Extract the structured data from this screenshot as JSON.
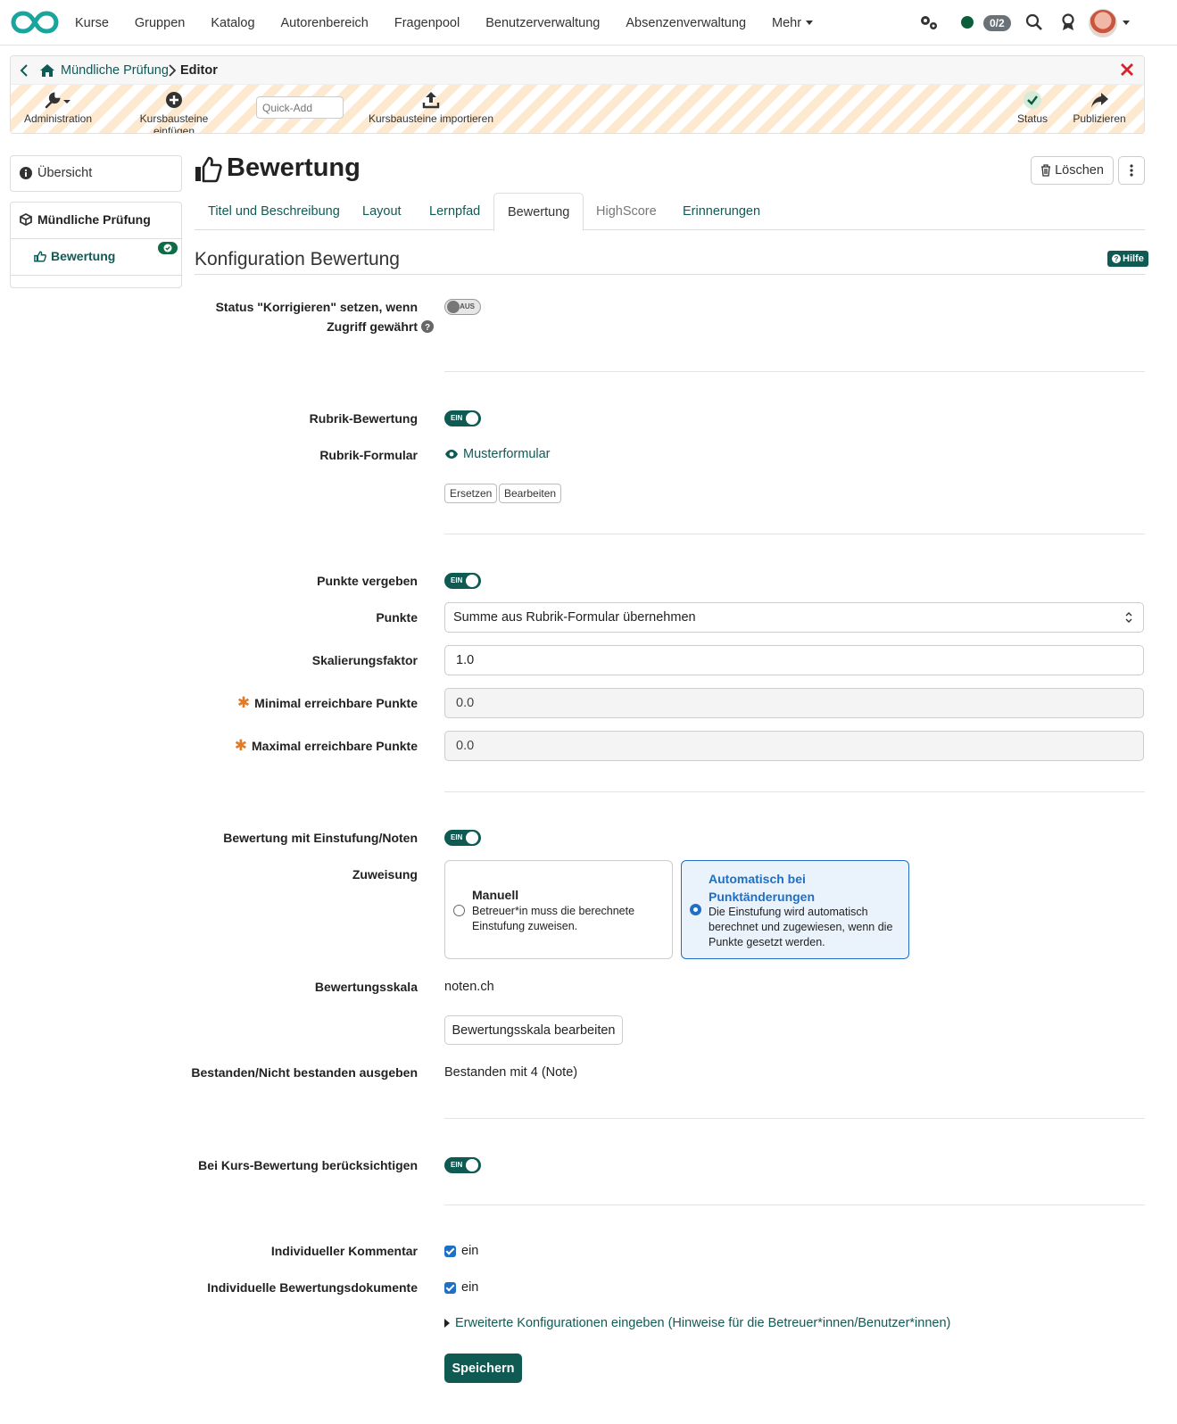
{
  "nav": {
    "items": [
      "Kurse",
      "Gruppen",
      "Katalog",
      "Autorenbereich",
      "Fragenpool",
      "Benutzerverwaltung",
      "Absenzenverwaltung"
    ],
    "more": "Mehr",
    "counter": "0/2"
  },
  "editor": {
    "breadcrumb_course": "Mündliche Prüfung",
    "breadcrumb_current": "Editor",
    "tools": {
      "administration": "Administration",
      "insert": "Kursbausteine einfügen",
      "quickadd_placeholder": "Quick-Add",
      "import": "Kursbausteine importieren",
      "status": "Status",
      "publish": "Publizieren"
    }
  },
  "sidebar": {
    "overview": "Übersicht",
    "course": "Mündliche Prüfung",
    "node": "Bewertung"
  },
  "header": {
    "title": "Bewertung",
    "delete": "Löschen"
  },
  "tabs": [
    "Titel und Beschreibung",
    "Layout",
    "Lernpfad",
    "Bewertung",
    "HighScore",
    "Erinnerungen"
  ],
  "section": {
    "title": "Konfiguration Bewertung",
    "help": "Hilfe"
  },
  "form": {
    "status_label_1": "Status \"Korrigieren\" setzen, wenn",
    "status_label_2": "Zugriff gewährt",
    "toggle_off": "AUS",
    "toggle_on": "EIN",
    "rubric_label": "Rubrik-Bewertung",
    "rubric_form_label": "Rubrik-Formular",
    "rubric_form_link": "Musterformular",
    "replace": "Ersetzen",
    "edit": "Bearbeiten",
    "points_label": "Punkte vergeben",
    "points_select_label": "Punkte",
    "points_select_value": "Summe aus Rubrik-Formular übernehmen",
    "scale_label": "Skalierungsfaktor",
    "scale_value": "1.0",
    "min_label": "Minimal erreichbare Punkte",
    "min_value": "0.0",
    "max_label": "Maximal erreichbare Punkte",
    "max_value": "0.0",
    "grade_label": "Bewertung mit Einstufung/Noten",
    "assign_label": "Zuweisung",
    "manual_title": "Manuell",
    "manual_desc": "Betreuer*in muss die berechnete Einstufung zuweisen.",
    "auto_title": "Automatisch bei Punktänderungen",
    "auto_desc": "Die Einstufung wird automatisch berechnet und zugewiesen, wenn die Punkte gesetzt werden.",
    "gradescale_label": "Bewertungsskala",
    "gradescale_value": "noten.ch",
    "gradescale_button": "Bewertungsskala bearbeiten",
    "passed_label": "Bestanden/Nicht bestanden ausgeben",
    "passed_value": "Bestanden mit 4 (Note)",
    "course_assess_label": "Bei Kurs-Bewertung berücksichtigen",
    "comment_label": "Individueller Kommentar",
    "comment_value": "ein",
    "docs_label": "Individuelle Bewertungsdokumente",
    "docs_value": "ein",
    "advanced": "Erweiterte Konfigurationen eingeben (Hinweise für die Betreuer*innen/Benutzer*innen)",
    "save": "Speichern"
  }
}
